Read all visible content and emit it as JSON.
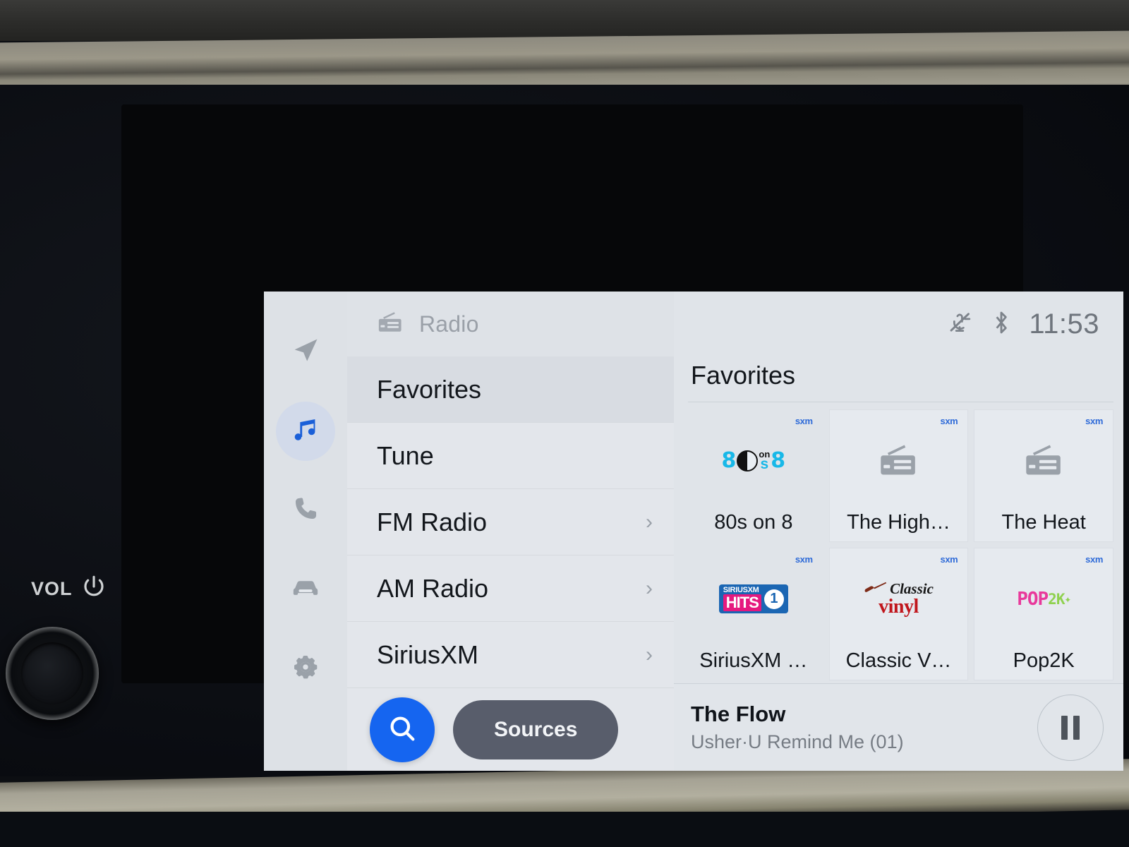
{
  "vehicle_controls": {
    "volume_label": "VOL",
    "power_icon": "power-icon",
    "knob_name": "volume-knob"
  },
  "sidebar": {
    "items": [
      {
        "icon": "navigation-arrow-icon",
        "name": "navigation",
        "active": false
      },
      {
        "icon": "music-note-icon",
        "name": "audio",
        "active": true
      },
      {
        "icon": "phone-icon",
        "name": "phone",
        "active": false
      },
      {
        "icon": "car-icon",
        "name": "vehicle",
        "active": false
      },
      {
        "icon": "gear-icon",
        "name": "settings",
        "active": false
      }
    ]
  },
  "header": {
    "source_icon": "radio-icon",
    "title": "Radio"
  },
  "status_bar": {
    "mic_muted_icon": "microphone-muted-icon",
    "bluetooth_icon": "bluetooth-icon",
    "time": "11:53"
  },
  "menu": {
    "items": [
      {
        "label": "Favorites",
        "selected": true,
        "chevron": ""
      },
      {
        "label": "Tune",
        "selected": false,
        "chevron": ""
      },
      {
        "label": "FM Radio",
        "selected": false,
        "chevron": "›"
      },
      {
        "label": "AM Radio",
        "selected": false,
        "chevron": "›"
      },
      {
        "label": "SiriusXM",
        "selected": false,
        "chevron": "›"
      }
    ]
  },
  "actions": {
    "search_icon": "search-icon",
    "sources_label": "Sources"
  },
  "favorites": {
    "heading": "Favorites",
    "badge_text": "sxm",
    "tiles": [
      {
        "label": "80s on 8",
        "logo": "80s-on-8-logo",
        "badge": "sxm"
      },
      {
        "label": "The High…",
        "logo": "generic-radio-icon",
        "badge": "sxm"
      },
      {
        "label": "The Heat",
        "logo": "generic-radio-icon",
        "badge": "sxm"
      },
      {
        "label": "SiriusXM …",
        "logo": "siriusxm-hits1-logo",
        "badge": "sxm"
      },
      {
        "label": "Classic V…",
        "logo": "classic-vinyl-logo",
        "badge": "sxm"
      },
      {
        "label": "Pop2K",
        "logo": "pop2k-logo",
        "badge": "sxm"
      }
    ],
    "logo_text": {
      "eighties_left": "8",
      "eighties_right": "8",
      "eighties_on": "on",
      "eighties_s": "s",
      "hits_top": "SIRIUSXM",
      "hits_big": "HITS",
      "hits_one": "1",
      "vinyl_classic": "Classic",
      "vinyl_word": "vinyl",
      "pop2k_pop": "POP",
      "pop2k_2k": "2K",
      "pop2k_star": "✦"
    }
  },
  "now_playing": {
    "title": "The Flow",
    "subtitle": "Usher·U Remind Me (01)",
    "transport_icon": "pause-icon"
  },
  "colors": {
    "accent_blue": "#1565f0",
    "sources_gray": "#585d6b",
    "screen_bg": "#dfe3e8",
    "sxm_blue": "#2f6bd8"
  }
}
